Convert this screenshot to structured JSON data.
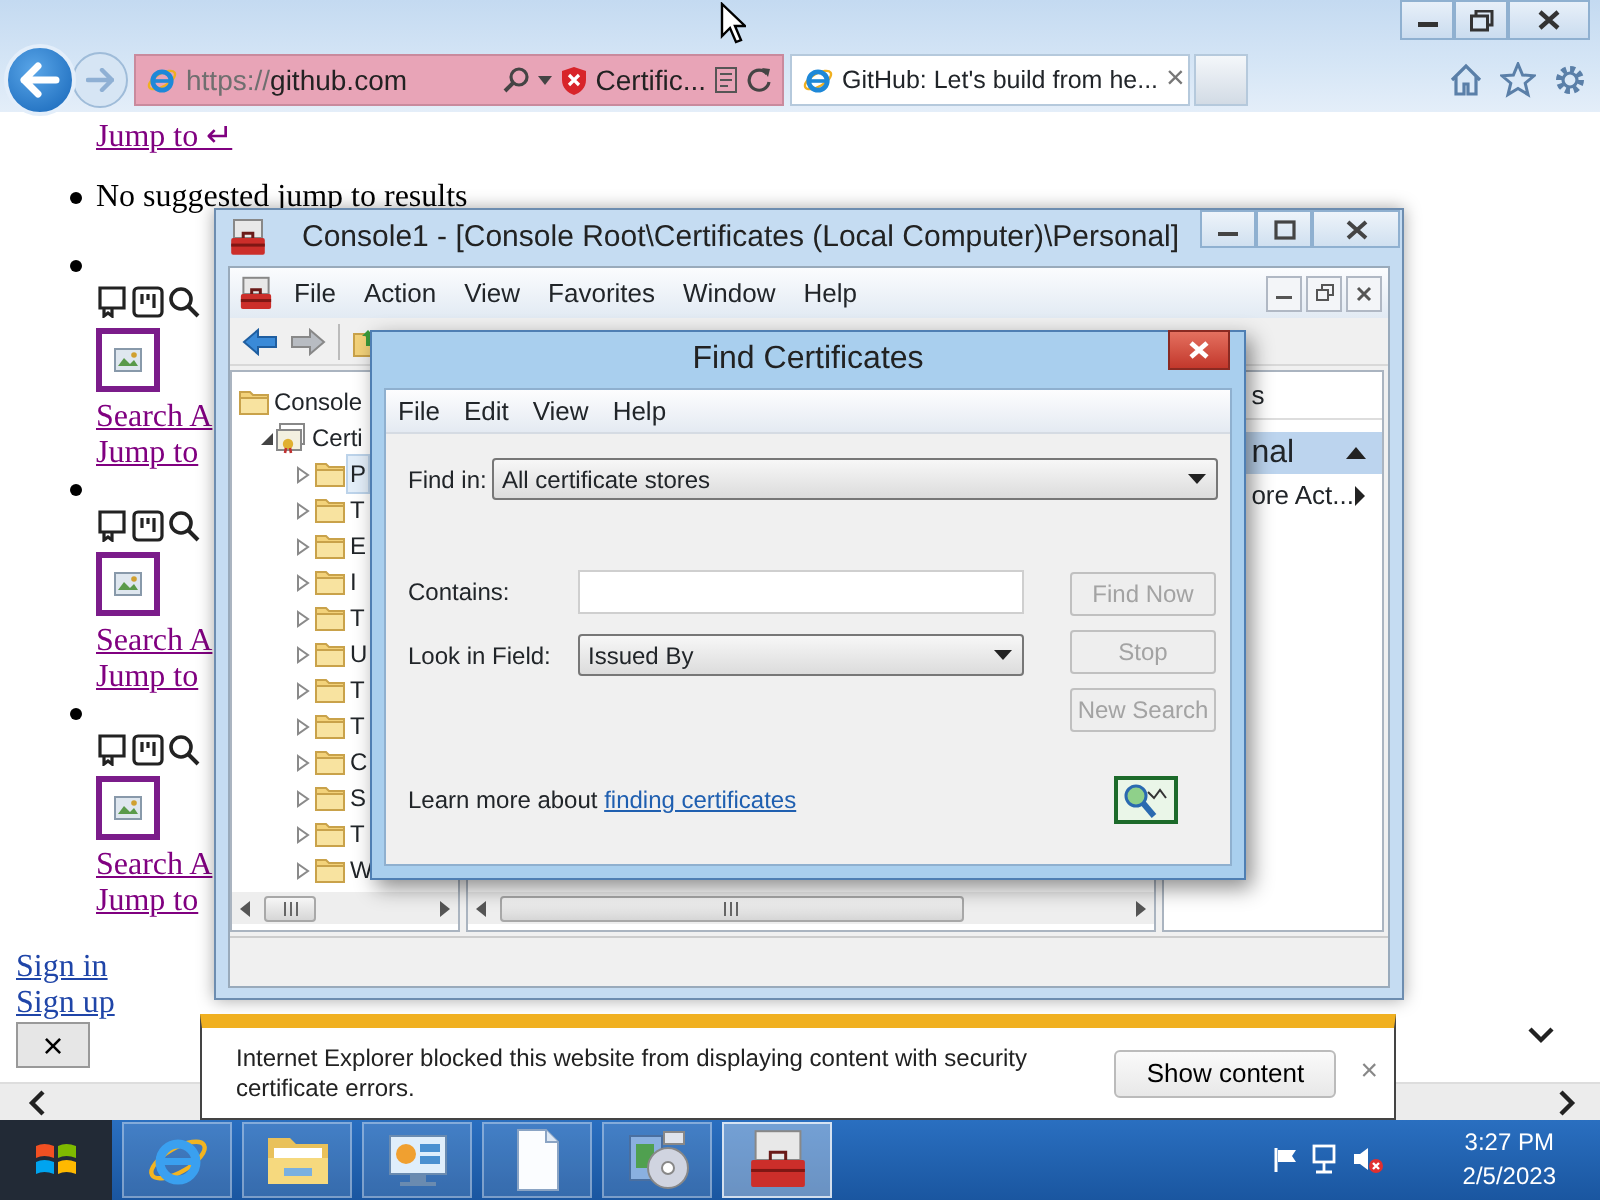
{
  "browser": {
    "scheme": "https://",
    "host": "github.com",
    "cert_status": "Certific...",
    "tab": {
      "title": "GitHub: Let's build from he...",
      "close": "×",
      "selected": true
    }
  },
  "page": {
    "jump_link": "Jump to ↵",
    "suggestion": "No suggested jump to results",
    "results": [
      {
        "search": "Search A",
        "jump": "Jump to"
      },
      {
        "search": "Search A",
        "jump": "Jump to"
      },
      {
        "search": "Search A",
        "jump": "Jump to"
      }
    ],
    "sign_in": "Sign in",
    "sign_up": "Sign up",
    "close": "×"
  },
  "console": {
    "title": "Console1 - [Console Root\\Certificates (Local Computer)\\Personal]",
    "menu": [
      "File",
      "Action",
      "View",
      "Favorites",
      "Window",
      "Help"
    ],
    "tree": [
      {
        "label": "Console",
        "children": [
          {
            "label": "Certi",
            "expanded": true,
            "selected": false,
            "children": [
              {
                "label": "P",
                "expanded": false,
                "selected": true
              },
              {
                "label": "T",
                "expanded": false,
                "selected": false
              },
              {
                "label": "E",
                "expanded": false,
                "selected": false
              },
              {
                "label": "I",
                "expanded": false,
                "selected": false
              },
              {
                "label": "T",
                "expanded": false,
                "selected": false
              },
              {
                "label": "U",
                "expanded": false,
                "selected": false
              },
              {
                "label": "T",
                "expanded": false,
                "selected": false
              },
              {
                "label": "T",
                "expanded": false,
                "selected": false
              },
              {
                "label": "C",
                "expanded": false,
                "selected": false
              },
              {
                "label": "S",
                "expanded": false,
                "selected": false
              },
              {
                "label": "T",
                "expanded": false,
                "selected": false
              },
              {
                "label": "W",
                "expanded": false,
                "selected": false
              }
            ]
          }
        ]
      }
    ],
    "actions": {
      "header": "s",
      "section": "nal",
      "item": "ore Act..."
    }
  },
  "dialog": {
    "title": "Find Certificates",
    "menu": [
      "File",
      "Edit",
      "View",
      "Help"
    ],
    "find_in": {
      "label": "Find in:",
      "value": "All certificate stores"
    },
    "contains": {
      "label": "Contains:"
    },
    "look_in": {
      "label": "Look in Field:",
      "value": "Issued By"
    },
    "buttons": [
      {
        "label": "Find Now",
        "disabled": true
      },
      {
        "label": "Stop",
        "disabled": true
      },
      {
        "label": "New Search",
        "disabled": true
      }
    ],
    "help": {
      "text": "Learn more about",
      "link": "finding certificates"
    }
  },
  "notification": {
    "message": "Internet Explorer blocked this website from displaying content with security certificate errors.",
    "button": "Show content",
    "close": "×"
  },
  "taskbar": {
    "apps": [
      {
        "kind": "browser",
        "active": false
      },
      {
        "kind": "folder",
        "active": false
      },
      {
        "kind": "control-panel",
        "active": false
      },
      {
        "kind": "document",
        "active": false
      },
      {
        "kind": "installer",
        "active": false
      },
      {
        "kind": "toolbox",
        "active": true
      }
    ],
    "time": "3:27 PM",
    "date": "2/5/2023"
  }
}
